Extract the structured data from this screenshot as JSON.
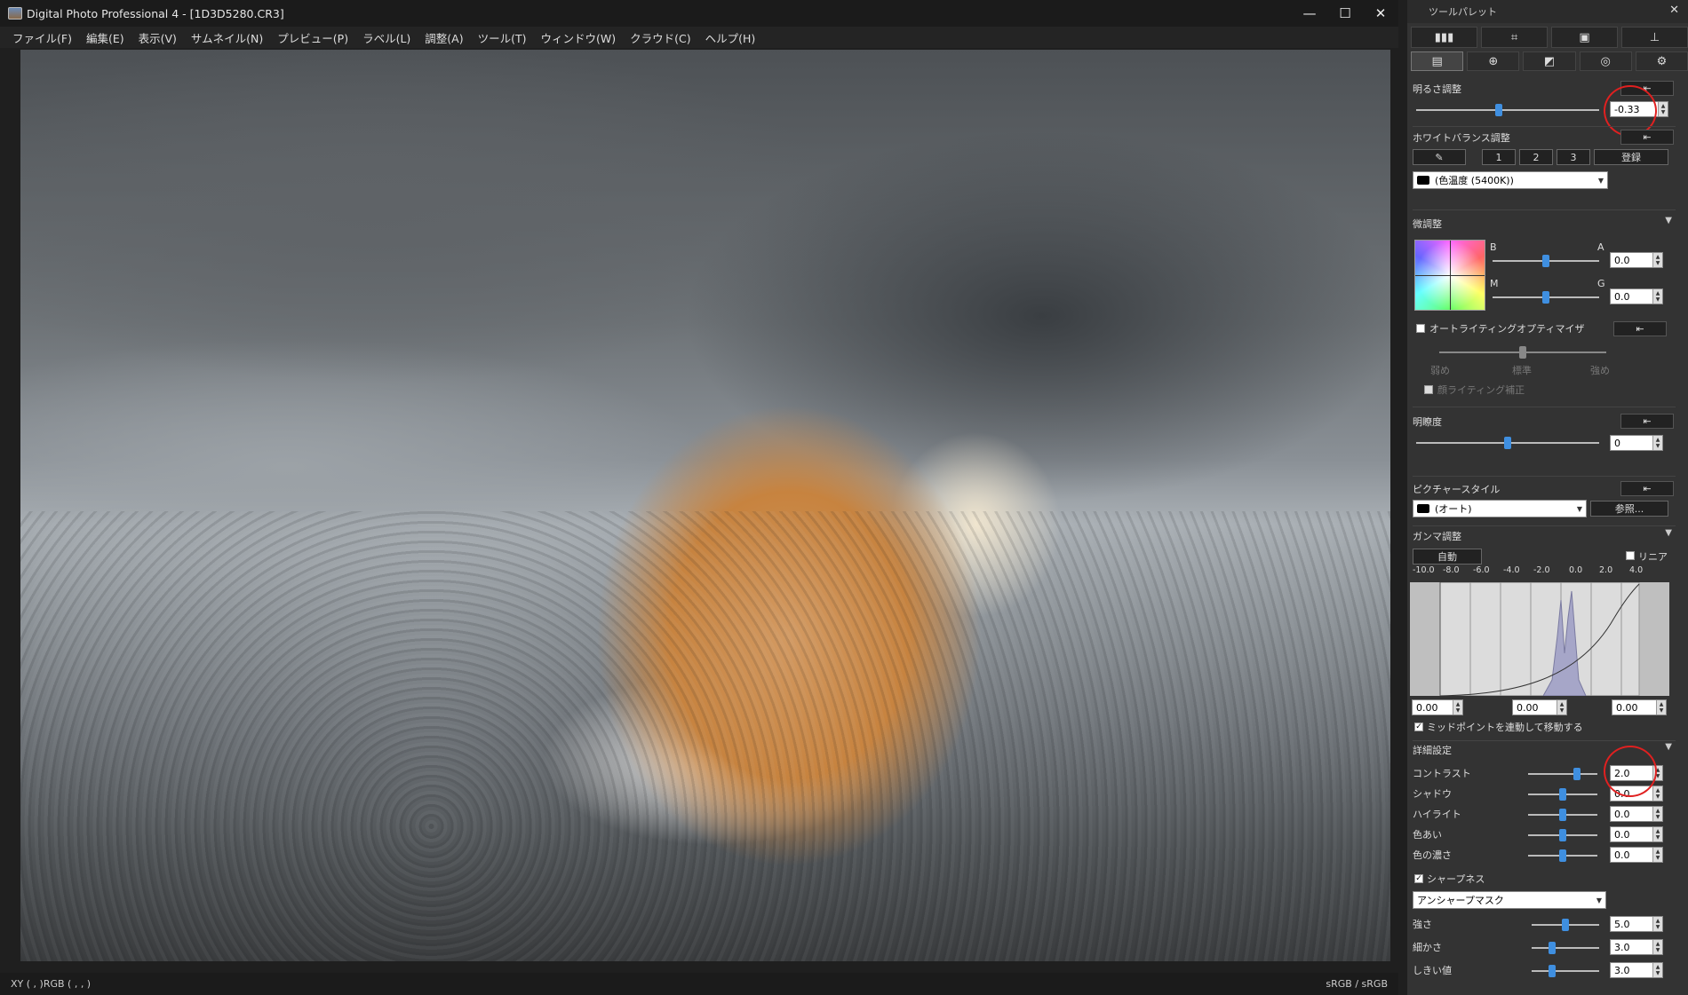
{
  "window": {
    "title": "Digital Photo Professional 4 - [1D3D5280.CR3]",
    "minimize": "—",
    "maximize": "☐",
    "close": "✕"
  },
  "menu": [
    "ファイル(F)",
    "編集(E)",
    "表示(V)",
    "サムネイル(N)",
    "プレビュー(P)",
    "ラベル(L)",
    "調整(A)",
    "ツール(T)",
    "ウィンドウ(W)",
    "クラウド(C)",
    "ヘルプ(H)"
  ],
  "status": {
    "left": "XY (    ,    )RGB (    ,    ,    )",
    "right": "sRGB / sRGB"
  },
  "palette": {
    "title": "ツールパレット",
    "close": "✕",
    "top_tabs": [
      "▮▮▮",
      "⌗",
      "▣",
      "⊥"
    ],
    "sub_tabs": [
      "▤",
      "⊕",
      "◩",
      "◎",
      "⚙"
    ],
    "reset_label": "⇤",
    "brightness": {
      "label": "明るさ調整",
      "value": "-0.33",
      "pos": 0.45
    },
    "wb": {
      "label": "ホワイトバランス調整",
      "eyedrop": "✎",
      "slots": [
        "1",
        "2",
        "3"
      ],
      "register": "登録",
      "select": "(色温度 (5400K))"
    },
    "fine": {
      "label": "微調整",
      "B": "B",
      "A": "A",
      "M": "M",
      "G": "G",
      "ba_value": "0.0",
      "mg_value": "0.0",
      "ba_pos": 0.5,
      "mg_pos": 0.5
    },
    "alo": {
      "label": "オートライティングオプティマイザ",
      "low": "弱め",
      "std": "標準",
      "high": "強め",
      "pos": 0.5,
      "face": "顔ライティング補正"
    },
    "clarity": {
      "label": "明瞭度",
      "value": "0",
      "pos": 0.5
    },
    "picstyle": {
      "label": "ピクチャースタイル",
      "select": "(オート)",
      "browse": "参照..."
    },
    "gamma": {
      "label": "ガンマ調整",
      "auto": "自動",
      "linear": "リニア",
      "ticks": [
        "-10.0",
        "-8.0",
        "-6.0",
        "-4.0",
        "-2.0",
        "0.0",
        "2.0",
        "4.0"
      ],
      "in1": "0.00",
      "in2": "0.00",
      "in3": "0.00",
      "midpoint": "ミッドポイントを連動して移動する"
    },
    "detail": {
      "label": "詳細設定",
      "rows": [
        {
          "label": "コントラスト",
          "value": "2.0",
          "pos": 0.7
        },
        {
          "label": "シャドウ",
          "value": "0.0",
          "pos": 0.5
        },
        {
          "label": "ハイライト",
          "value": "0.0",
          "pos": 0.5
        },
        {
          "label": "色あい",
          "value": "0.0",
          "pos": 0.5
        },
        {
          "label": "色の濃さ",
          "value": "0.0",
          "pos": 0.5
        }
      ]
    },
    "sharp": {
      "label": "シャープネス",
      "select": "アンシャープマスク",
      "rows": [
        {
          "label": "強さ",
          "value": "5.0",
          "pos": 0.5
        },
        {
          "label": "細かさ",
          "value": "3.0",
          "pos": 0.3
        },
        {
          "label": "しきい値",
          "value": "3.0",
          "pos": 0.3
        }
      ]
    }
  }
}
